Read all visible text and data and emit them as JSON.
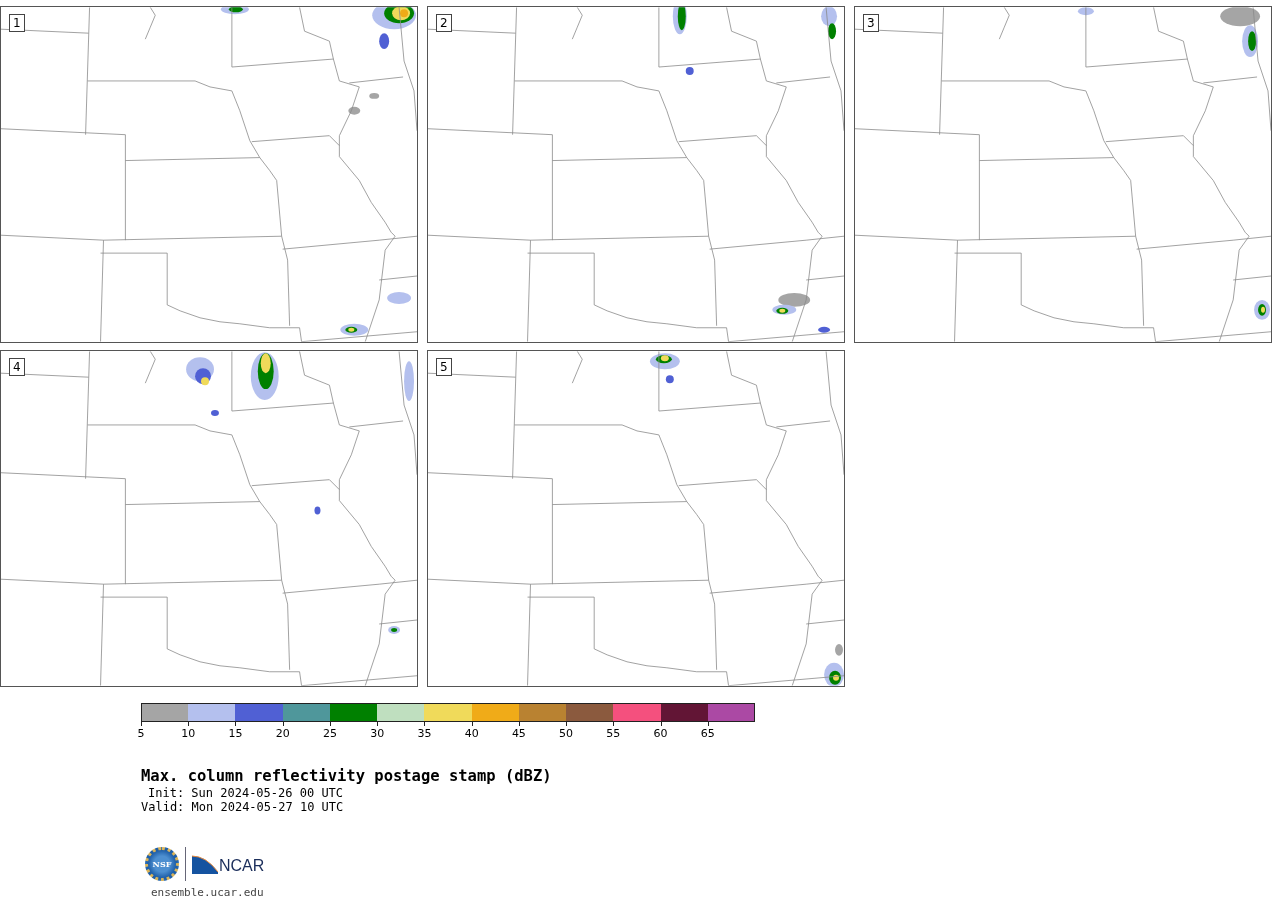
{
  "panels": [
    {
      "label": "1"
    },
    {
      "label": "2"
    },
    {
      "label": "3"
    },
    {
      "label": "4"
    },
    {
      "label": "5"
    }
  ],
  "colorbar": {
    "segments": [
      {
        "label": "5",
        "color": "#a5a5a5"
      },
      {
        "label": "10",
        "color": "#b4c0ee"
      },
      {
        "label": "15",
        "color": "#5060d4"
      },
      {
        "label": "20",
        "color": "#4f979b"
      },
      {
        "label": "25",
        "color": "#008000"
      },
      {
        "label": "30",
        "color": "#bfdfbf"
      },
      {
        "label": "35",
        "color": "#f0da5a"
      },
      {
        "label": "40",
        "color": "#f0ab18"
      },
      {
        "label": "45",
        "color": "#b98231"
      },
      {
        "label": "50",
        "color": "#8b5a3e"
      },
      {
        "label": "55",
        "color": "#f4507e"
      },
      {
        "label": "60",
        "color": "#621535"
      },
      {
        "label": "65",
        "color": "#ab49a4"
      }
    ]
  },
  "title": "Max. column reflectivity postage stamp (dBZ)",
  "init": "Init: Sun 2024-05-26 00 UTC",
  "valid": "Valid: Mon 2024-05-27 10 UTC",
  "logos": {
    "nsf": "NSF",
    "ncar": "NCAR"
  },
  "url": "ensemble.ucar.edu"
}
